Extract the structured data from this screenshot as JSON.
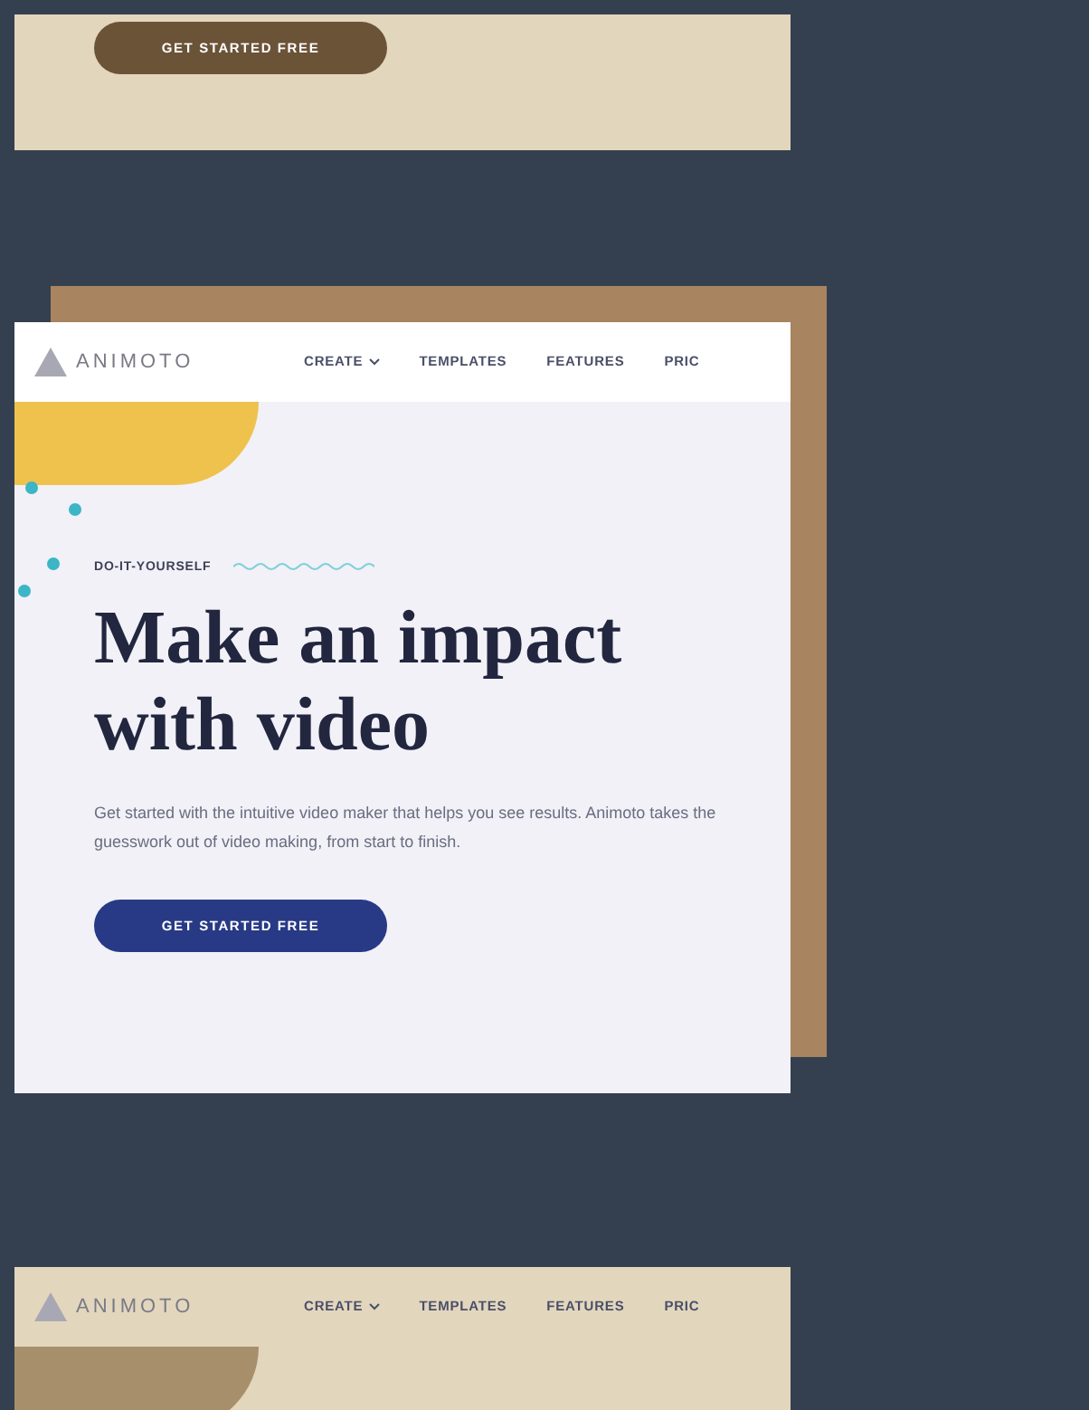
{
  "top_panel": {
    "button": "GET STARTED FREE"
  },
  "hero_card": {
    "logo": "ANIMOTO",
    "nav": [
      {
        "label": "CREATE",
        "dropdown": true
      },
      {
        "label": "TEMPLATES",
        "dropdown": false
      },
      {
        "label": "FEATURES",
        "dropdown": false
      },
      {
        "label": "PRIC",
        "dropdown": false
      }
    ],
    "kicker": "DO-IT-YOURSELF",
    "heading": "Make an impact with video",
    "text": "Get started with the intuitive video maker that helps you see results. Animoto takes the guesswork out of video making, from start to finish.",
    "button": "GET STARTED FREE"
  },
  "bottom_panel": {
    "logo": "ANIMOTO",
    "nav": [
      {
        "label": "CREATE",
        "dropdown": true
      },
      {
        "label": "TEMPLATES",
        "dropdown": false
      },
      {
        "label": "FEATURES",
        "dropdown": false
      },
      {
        "label": "PRIC",
        "dropdown": false
      }
    ]
  }
}
